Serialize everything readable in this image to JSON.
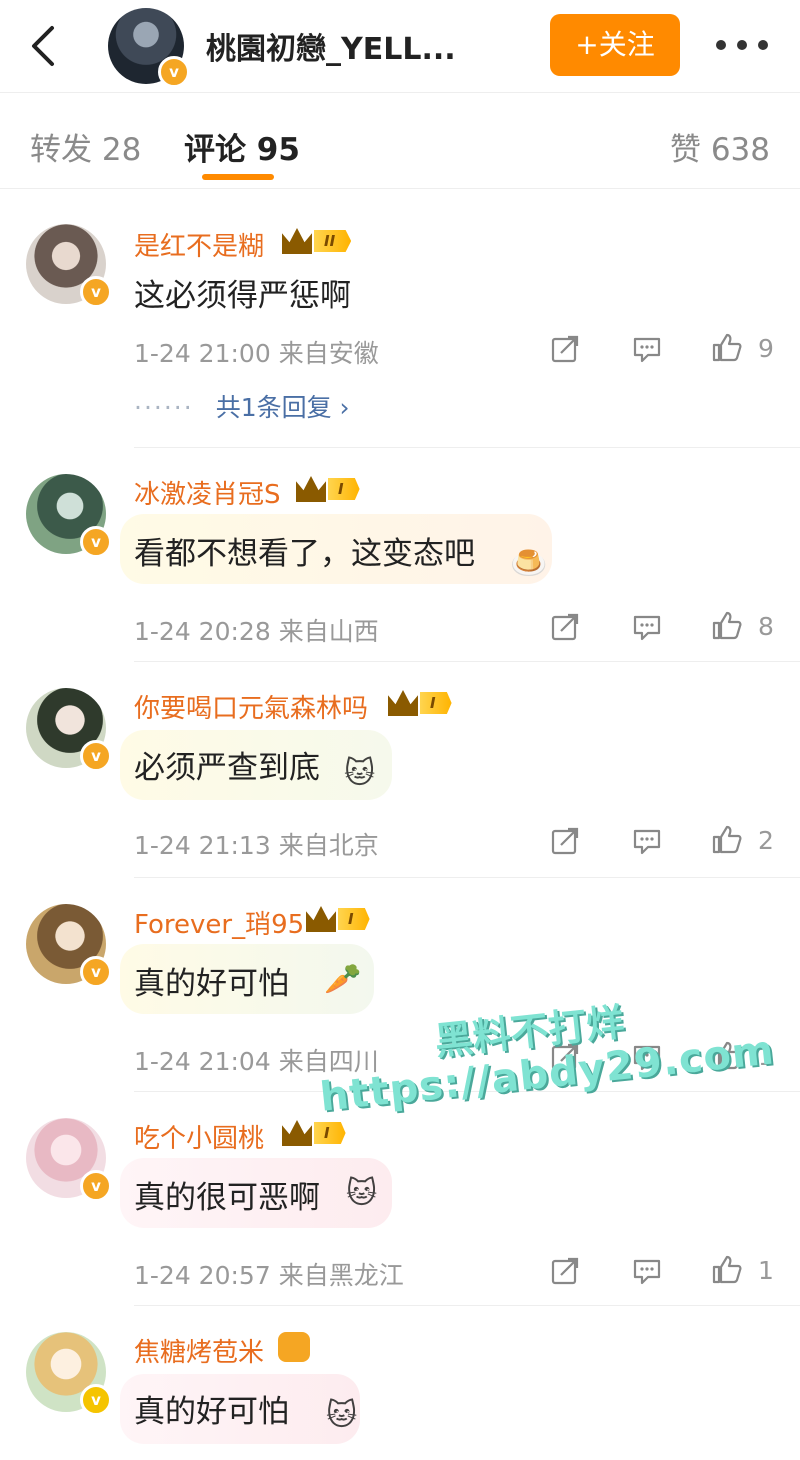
{
  "header": {
    "back_icon": "chevron-left-icon",
    "title": "桃園初戀_YELL...",
    "follow_label": "+关注",
    "more_icon": "more-horizontal-icon",
    "verified_badge": "v"
  },
  "tabs": {
    "repost": "转发 28",
    "comment": "评论 95",
    "like": "赞 638"
  },
  "comments": [
    {
      "user": "是红不是糊",
      "level": "II",
      "text": "这必须得严惩啊",
      "time": "1-24 21:00",
      "location": "来自安徽",
      "likes": "9",
      "replies": "共1条回复 ›",
      "replies_dots": "······"
    },
    {
      "user": "冰激凌肖冠S",
      "level": "I",
      "text": "看都不想看了，这变态吧",
      "time": "1-24 20:28",
      "location": "来自山西",
      "likes": "8"
    },
    {
      "user": "你要喝口元氣森林吗",
      "level": "I",
      "text": "必须严查到底",
      "time": "1-24 21:13",
      "location": "来自北京",
      "likes": "2"
    },
    {
      "user": "Forever_琑95",
      "level": "I",
      "text": "真的好可怕",
      "time": "1-24 21:04",
      "location": "来自四川",
      "likes": "1"
    },
    {
      "user": "吃个小圆桃",
      "level": "I",
      "text": "真的很可恶啊",
      "time": "1-24 20:57",
      "location": "来自黑龙江",
      "likes": "1"
    },
    {
      "user": "焦糖烤苞米",
      "level": "",
      "text": "真的好可怕"
    }
  ],
  "watermark": {
    "line1": "黑料不打烊",
    "line2": "https://abdy29.com"
  },
  "colors": {
    "accent": "#ff8a00",
    "username": "#e86d1f",
    "badge": "#f5a623",
    "watermark": "#7fe3d2"
  },
  "icons": [
    "share-icon",
    "comment-icon",
    "thumbs-up-icon",
    "crown-icon"
  ]
}
